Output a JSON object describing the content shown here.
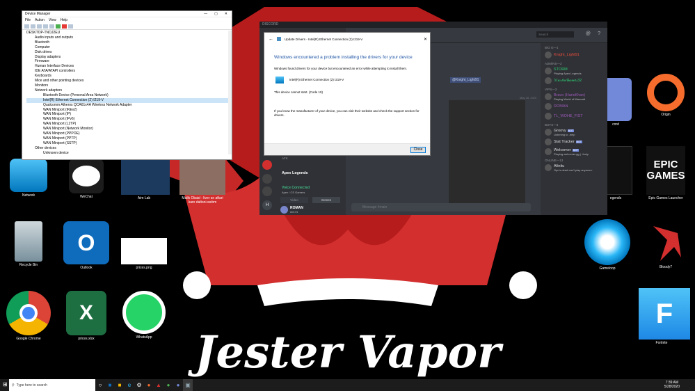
{
  "wallpaper_text": "Jester Vapor",
  "desktop_icons": {
    "network": "Network",
    "wechat": "WeChat",
    "aimlab": "Aim Lab",
    "video": "Malik Obaid - liver se aftari karo daltoni.webm",
    "recycle": "Recycle Bin",
    "outlook": "Outlook",
    "prices_png": "prices.png",
    "chrome": "Google Chrome",
    "prices_xlsx": "prices.xlsx",
    "whatsapp": "WhatsApp",
    "origin": "Origin",
    "epic": "Epic Games Launcher",
    "gameloop": "Gameloop",
    "bloody": "Bloody7",
    "fortnite": "Fortnite",
    "discord_cut": "cord",
    "legends_cut": "egends"
  },
  "device_manager": {
    "title": "Device Manager",
    "menu": [
      "File",
      "Action",
      "View",
      "Help"
    ],
    "tree": [
      "DESKTOP-TNOJ2EU",
      "Audio inputs and outputs",
      "Bluetooth",
      "Computer",
      "Disk drives",
      "Display adapters",
      "Firmware",
      "Human Interface Devices",
      "IDE ATA/ATAPI controllers",
      "Keyboards",
      "Mice and other pointing devices",
      "Monitors",
      "Network adapters",
      "Bluetooth Device (Personal Area Network)",
      "Intel(R) Ethernet Connection (2) I219-V",
      "Qualcomm Atheros QCA61x4A Wireless Network Adapter",
      "WAN Miniport (IKEv2)",
      "WAN Miniport (IP)",
      "WAN Miniport (IPv6)",
      "WAN Miniport (L2TP)",
      "WAN Miniport (Network Monitor)",
      "WAN Miniport (PPPOE)",
      "WAN Miniport (PPTP)",
      "WAN Miniport (SSTP)",
      "Other devices",
      "Unknown device"
    ]
  },
  "discord": {
    "title": "DISCORD",
    "search_placeholder": "Search",
    "voice_channel": "Apex Legends",
    "afk": "AFK",
    "voice_connected": "Voice Connected",
    "voice_sub": "Apex / CS Gamers",
    "video_btn": "Video",
    "screen_btn": "Screen",
    "user_name": "ROMAN",
    "user_tag": "#0174",
    "mention": "@Knight_Light91",
    "date": "May 28, 2020",
    "message_placeholder": "Message #main",
    "members": [
      {
        "group": "BIG G—1"
      },
      {
        "name": "Knight_Light91",
        "color": "#e74c3c"
      },
      {
        "group": "ADMINS—2"
      },
      {
        "name": "STORM",
        "sub": "Playing Apex Legends",
        "color": "#2ecc71"
      },
      {
        "name": "ℳ𝒶𝓇𝓉𝒾𝓃𝒢𝒶𝓂𝑒𝓈32",
        "color": "#2ecc71"
      },
      {
        "group": "VIPS—3"
      },
      {
        "name": "Bravo (HarisKhan)",
        "sub": "Playing World of Warcraft",
        "color": "#9b59b6"
      },
      {
        "name": "ROMAN",
        "color": "#9b59b6"
      },
      {
        "name": "TL_WOHE_FIST",
        "color": "#9b59b6"
      },
      {
        "group": "BOTS—3"
      },
      {
        "name": "Groovy",
        "sub": "Listening to -help",
        "color": "#dcddde",
        "bot": "BOT"
      },
      {
        "name": "Stat Tracker",
        "color": "#dcddde",
        "bot": "BOT"
      },
      {
        "name": "Welcomer",
        "sub": "Playing welcomer.gg | +help",
        "color": "#dcddde",
        "bot": "BOT"
      },
      {
        "group": "ONLINE—13"
      },
      {
        "name": "Afinitu",
        "sub": "Gpu's dead can't play anymore.",
        "color": "#dcddde"
      }
    ]
  },
  "update_dialog": {
    "window_title": "Update Drivers - Intel(R) Ethernet Connection (2) I219-V",
    "heading": "Windows encountered a problem installing the drivers for your device",
    "p1": "Windows found drivers for your device but encountered an error while attempting to install them.",
    "device": "Intel(R) Ethernet Connection (2) I219-V",
    "p2": "This device cannot start. (Code 10)",
    "p3": "If you know the manufacturer of your device, you can visit their website and check the support section for drivers.",
    "close": "Close"
  },
  "taskbar": {
    "search_placeholder": "Type here to search",
    "time": "7:39 AM",
    "date": "5/28/2020"
  },
  "colors": {
    "accent": "#e53935",
    "discord_bg": "#36393f",
    "link_blue": "#1f55a5"
  }
}
